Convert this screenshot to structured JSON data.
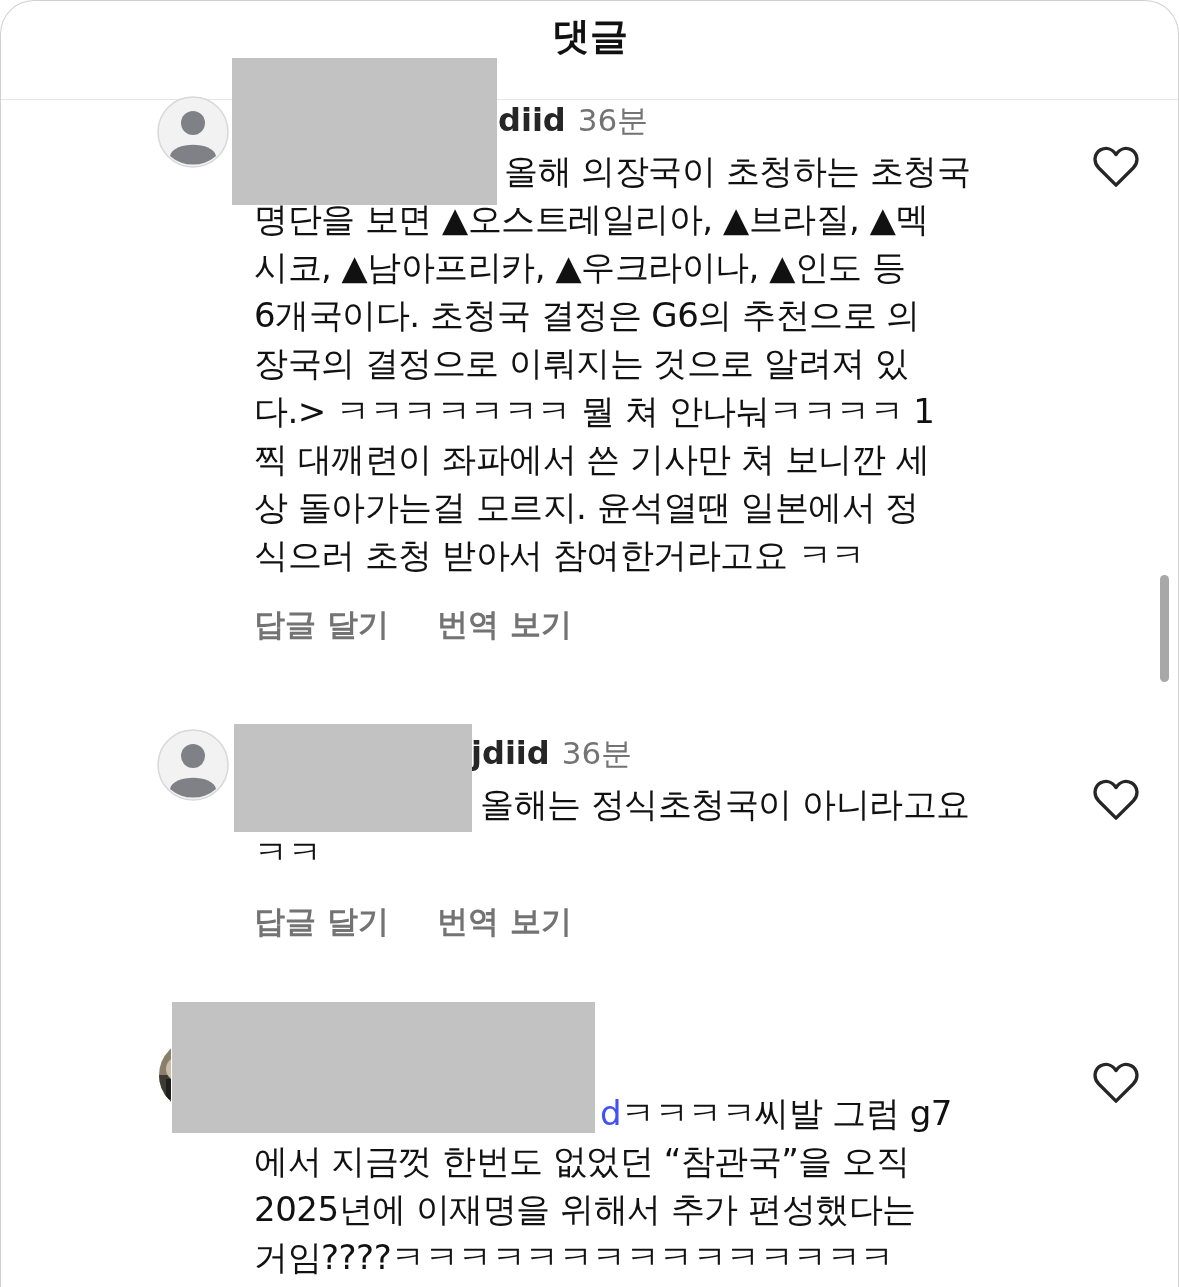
{
  "title": "댓글",
  "comments": [
    {
      "kind": "default",
      "username": "diid",
      "time": "36분",
      "liked": false,
      "lines": [
        "올해 의장국이 초청하는 초청국",
        "명단을 보면 ▲오스트레일리아, ▲브라질, ▲멕",
        "시코, ▲남아프리카, ▲우크라이나, ▲인도 등",
        "6개국이다. 초청국 결정은 G6의 추천으로 의",
        "장국의 결정으로 이뤄지는 것으로 알려져 있",
        "다.> ㅋㅋㅋㅋㅋㅋㅋ 뭘 쳐 안나눠ㅋㅋㅋㅋ 1",
        "찍 대깨련이 좌파에서 쓴 기사만 쳐 보니깐 세",
        "상 돌아가는걸 모르지. 윤석열땐 일본에서 정",
        "식으러 초청 받아서 참여한거라고요 ㅋㅋ"
      ],
      "actions": [
        "답글 달기",
        "번역 보기"
      ]
    },
    {
      "kind": "default",
      "username": "jdiid",
      "time": "36분",
      "liked": false,
      "lines": [
        "올해는 정식초청국이 아니라고요",
        "ㅋㅋ"
      ],
      "actions": [
        "답글 달기",
        "번역 보기"
      ]
    },
    {
      "mention": "d",
      "liked": false,
      "lines": [
        "ㅋㅋㅋㅋ씨발 그럼 g7",
        "에서 지금껏 한번도 없었던 “참관국”을 오직",
        "2025년에 이재명을 위해서 추가 편성했다는",
        "거임????ㅋㅋㅋㅋㅋㅋㅋㅋㅋㅋㅋㅋㅋㅋㅋ"
      ]
    }
  ]
}
